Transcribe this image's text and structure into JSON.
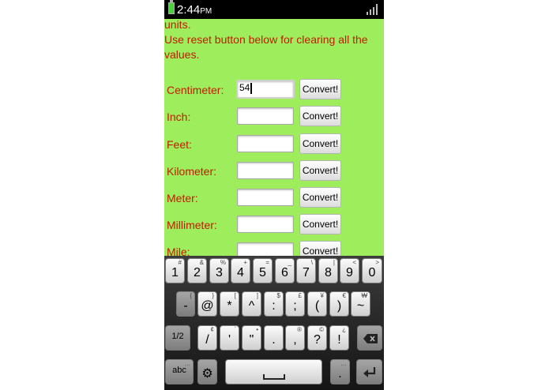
{
  "status_bar": {
    "time": "2:44",
    "ampm": "PM"
  },
  "intro": {
    "line1": "units.",
    "line2": "Use reset button below for clearing all the values."
  },
  "converter": {
    "convert_label": "Convert!",
    "rows": [
      {
        "label": "Centimeter:",
        "value": "54"
      },
      {
        "label": "Inch:",
        "value": ""
      },
      {
        "label": "Feet:",
        "value": ""
      },
      {
        "label": "Kilometer:",
        "value": ""
      },
      {
        "label": "Meter:",
        "value": ""
      },
      {
        "label": "Millimeter:",
        "value": ""
      },
      {
        "label": "Mile:",
        "value": ""
      }
    ]
  },
  "keyboard": {
    "row1": [
      {
        "main": "1",
        "sub": "#"
      },
      {
        "main": "2",
        "sub": "&"
      },
      {
        "main": "3",
        "sub": "%"
      },
      {
        "main": "4",
        "sub": "+"
      },
      {
        "main": "5",
        "sub": "="
      },
      {
        "main": "6",
        "sub": "_"
      },
      {
        "main": "7",
        "sub": "\\"
      },
      {
        "main": "8",
        "sub": "|"
      },
      {
        "main": "9",
        "sub": "<"
      },
      {
        "main": "0",
        "sub": ">"
      }
    ],
    "row2": [
      {
        "main": "-",
        "sub": "{"
      },
      {
        "main": "@",
        "sub": "}"
      },
      {
        "main": "*",
        "sub": "["
      },
      {
        "main": "^",
        "sub": "]"
      },
      {
        "main": ":",
        "sub": "$"
      },
      {
        "main": ";",
        "sub": "£"
      },
      {
        "main": "(",
        "sub": "¥"
      },
      {
        "main": ")",
        "sub": "€"
      },
      {
        "main": "~",
        "sub": "₩"
      }
    ],
    "row3": [
      {
        "main": "/",
        "sub": "¢"
      },
      {
        "main": "'",
        "sub": "`"
      },
      {
        "main": "\"",
        "sub": "•"
      },
      {
        "main": ".",
        "sub": ""
      },
      {
        "main": ",",
        "sub": "®"
      },
      {
        "main": "?",
        "sub": "©"
      },
      {
        "main": "!",
        "sub": "¿"
      }
    ],
    "mode_label": "1/2",
    "abc_label": "abc",
    "period_label": ".",
    "period_sub": "…",
    "abc_sub": "…"
  }
}
